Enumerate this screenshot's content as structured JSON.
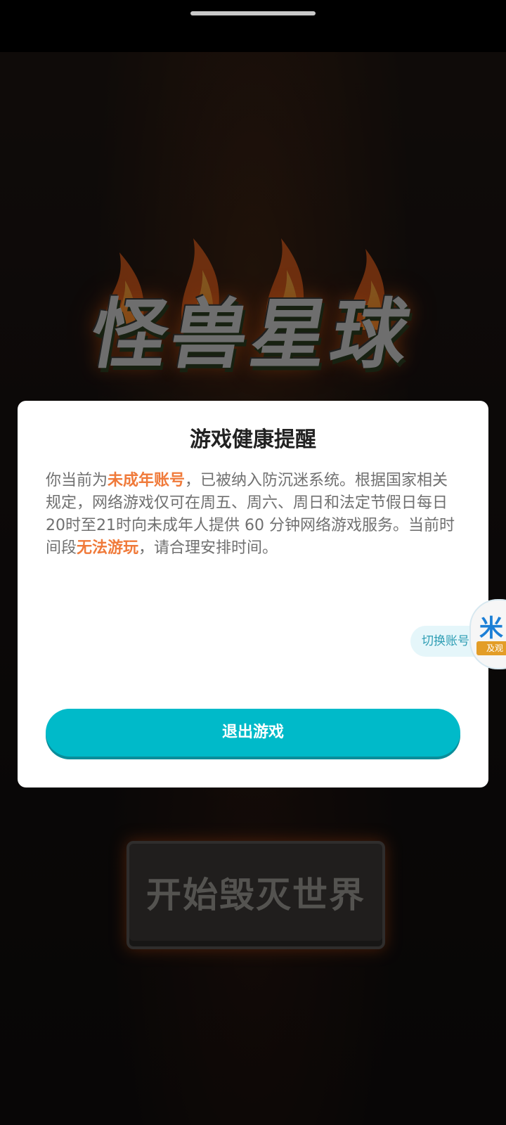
{
  "game": {
    "logo_text": "怪兽星球",
    "start_button_label": "开始毁灭世界"
  },
  "dialog": {
    "title": "游戏健康提醒",
    "message_parts": {
      "p1": "你当前为",
      "hl1": "未成年账号",
      "p2": "，已被纳入防沉迷系统。根据国家相关规定，网络游戏仅可在周五、周六、周日和法定节假日每日20时至21时向未成年人提供 60 分钟网络游戏服务。当前时间段",
      "hl2": "无法游玩",
      "p3": "，请合理安排时间。"
    },
    "exit_button_label": "退出游戏"
  },
  "floating": {
    "switch_account_label": "切换账号",
    "ball_glyph": "米",
    "ball_tag": "及观",
    "ball_icon": "mi-floating-ball-icon"
  },
  "colors": {
    "accent": "#00bac9",
    "highlight": "#f07a3a",
    "dialog_bg": "#ffffff"
  }
}
